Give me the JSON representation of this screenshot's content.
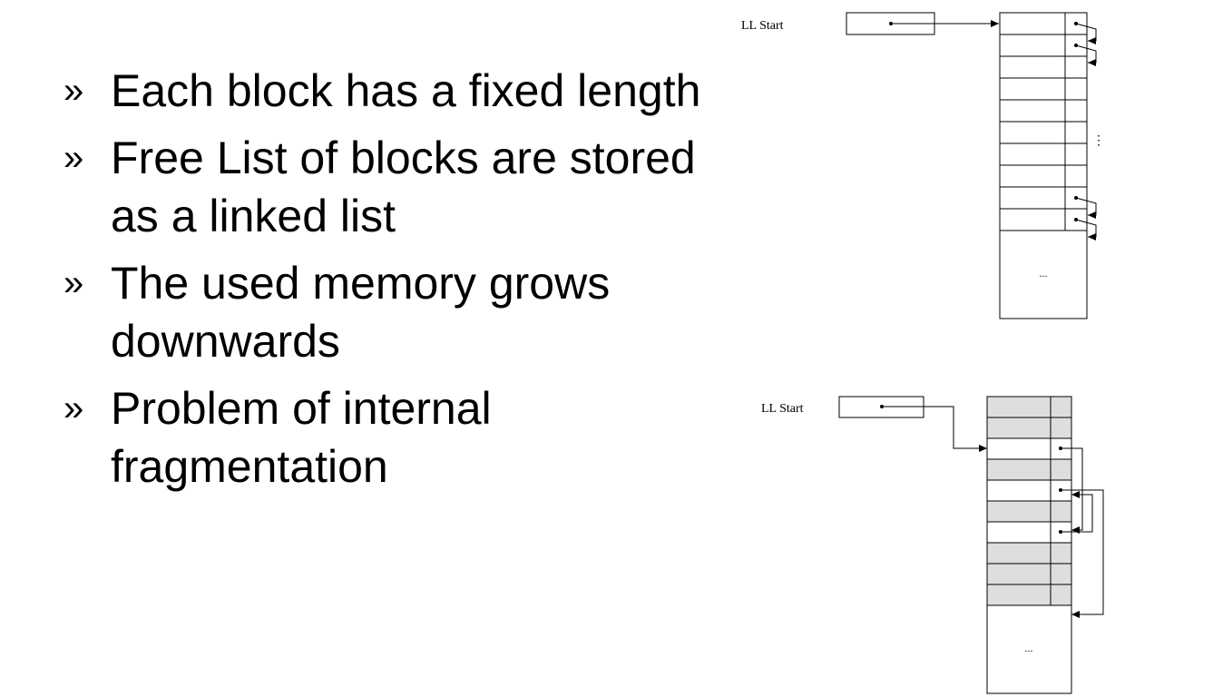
{
  "bullets": [
    {
      "marker": "»",
      "text": "Each block has a fixed length"
    },
    {
      "marker": "»",
      "text": "Free List of blocks are stored as a linked list"
    },
    {
      "marker": "»",
      "text": "The used memory grows downwards"
    },
    {
      "marker": "»",
      "text": "Problem of internal fragmentation"
    }
  ],
  "diagrams": {
    "top": {
      "start_label": "LL Start",
      "ellipsis_mid": "⋮",
      "ellipsis_bottom": "..."
    },
    "bottom": {
      "start_label": "LL Start",
      "ellipsis_bottom": "...",
      "used_fill": "#dedede"
    }
  }
}
